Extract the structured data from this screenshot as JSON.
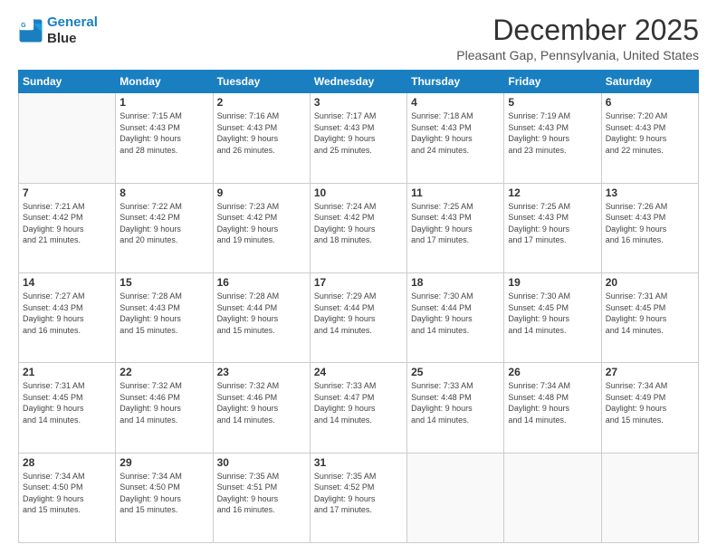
{
  "logo": {
    "line1": "General",
    "line2": "Blue"
  },
  "title": "December 2025",
  "subtitle": "Pleasant Gap, Pennsylvania, United States",
  "weekdays": [
    "Sunday",
    "Monday",
    "Tuesday",
    "Wednesday",
    "Thursday",
    "Friday",
    "Saturday"
  ],
  "weeks": [
    [
      {
        "day": "",
        "sunrise": "",
        "sunset": "",
        "daylight": ""
      },
      {
        "day": "1",
        "sunrise": "7:15 AM",
        "sunset": "4:43 PM",
        "daylight": "9 hours and 28 minutes."
      },
      {
        "day": "2",
        "sunrise": "7:16 AM",
        "sunset": "4:43 PM",
        "daylight": "9 hours and 26 minutes."
      },
      {
        "day": "3",
        "sunrise": "7:17 AM",
        "sunset": "4:43 PM",
        "daylight": "9 hours and 25 minutes."
      },
      {
        "day": "4",
        "sunrise": "7:18 AM",
        "sunset": "4:43 PM",
        "daylight": "9 hours and 24 minutes."
      },
      {
        "day": "5",
        "sunrise": "7:19 AM",
        "sunset": "4:43 PM",
        "daylight": "9 hours and 23 minutes."
      },
      {
        "day": "6",
        "sunrise": "7:20 AM",
        "sunset": "4:43 PM",
        "daylight": "9 hours and 22 minutes."
      }
    ],
    [
      {
        "day": "7",
        "sunrise": "7:21 AM",
        "sunset": "4:42 PM",
        "daylight": "9 hours and 21 minutes."
      },
      {
        "day": "8",
        "sunrise": "7:22 AM",
        "sunset": "4:42 PM",
        "daylight": "9 hours and 20 minutes."
      },
      {
        "day": "9",
        "sunrise": "7:23 AM",
        "sunset": "4:42 PM",
        "daylight": "9 hours and 19 minutes."
      },
      {
        "day": "10",
        "sunrise": "7:24 AM",
        "sunset": "4:42 PM",
        "daylight": "9 hours and 18 minutes."
      },
      {
        "day": "11",
        "sunrise": "7:25 AM",
        "sunset": "4:43 PM",
        "daylight": "9 hours and 17 minutes."
      },
      {
        "day": "12",
        "sunrise": "7:25 AM",
        "sunset": "4:43 PM",
        "daylight": "9 hours and 17 minutes."
      },
      {
        "day": "13",
        "sunrise": "7:26 AM",
        "sunset": "4:43 PM",
        "daylight": "9 hours and 16 minutes."
      }
    ],
    [
      {
        "day": "14",
        "sunrise": "7:27 AM",
        "sunset": "4:43 PM",
        "daylight": "9 hours and 16 minutes."
      },
      {
        "day": "15",
        "sunrise": "7:28 AM",
        "sunset": "4:43 PM",
        "daylight": "9 hours and 15 minutes."
      },
      {
        "day": "16",
        "sunrise": "7:28 AM",
        "sunset": "4:44 PM",
        "daylight": "9 hours and 15 minutes."
      },
      {
        "day": "17",
        "sunrise": "7:29 AM",
        "sunset": "4:44 PM",
        "daylight": "9 hours and 14 minutes."
      },
      {
        "day": "18",
        "sunrise": "7:30 AM",
        "sunset": "4:44 PM",
        "daylight": "9 hours and 14 minutes."
      },
      {
        "day": "19",
        "sunrise": "7:30 AM",
        "sunset": "4:45 PM",
        "daylight": "9 hours and 14 minutes."
      },
      {
        "day": "20",
        "sunrise": "7:31 AM",
        "sunset": "4:45 PM",
        "daylight": "9 hours and 14 minutes."
      }
    ],
    [
      {
        "day": "21",
        "sunrise": "7:31 AM",
        "sunset": "4:45 PM",
        "daylight": "9 hours and 14 minutes."
      },
      {
        "day": "22",
        "sunrise": "7:32 AM",
        "sunset": "4:46 PM",
        "daylight": "9 hours and 14 minutes."
      },
      {
        "day": "23",
        "sunrise": "7:32 AM",
        "sunset": "4:46 PM",
        "daylight": "9 hours and 14 minutes."
      },
      {
        "day": "24",
        "sunrise": "7:33 AM",
        "sunset": "4:47 PM",
        "daylight": "9 hours and 14 minutes."
      },
      {
        "day": "25",
        "sunrise": "7:33 AM",
        "sunset": "4:48 PM",
        "daylight": "9 hours and 14 minutes."
      },
      {
        "day": "26",
        "sunrise": "7:34 AM",
        "sunset": "4:48 PM",
        "daylight": "9 hours and 14 minutes."
      },
      {
        "day": "27",
        "sunrise": "7:34 AM",
        "sunset": "4:49 PM",
        "daylight": "9 hours and 15 minutes."
      }
    ],
    [
      {
        "day": "28",
        "sunrise": "7:34 AM",
        "sunset": "4:50 PM",
        "daylight": "9 hours and 15 minutes."
      },
      {
        "day": "29",
        "sunrise": "7:34 AM",
        "sunset": "4:50 PM",
        "daylight": "9 hours and 15 minutes."
      },
      {
        "day": "30",
        "sunrise": "7:35 AM",
        "sunset": "4:51 PM",
        "daylight": "9 hours and 16 minutes."
      },
      {
        "day": "31",
        "sunrise": "7:35 AM",
        "sunset": "4:52 PM",
        "daylight": "9 hours and 17 minutes."
      },
      {
        "day": "",
        "sunrise": "",
        "sunset": "",
        "daylight": ""
      },
      {
        "day": "",
        "sunrise": "",
        "sunset": "",
        "daylight": ""
      },
      {
        "day": "",
        "sunrise": "",
        "sunset": "",
        "daylight": ""
      }
    ]
  ]
}
